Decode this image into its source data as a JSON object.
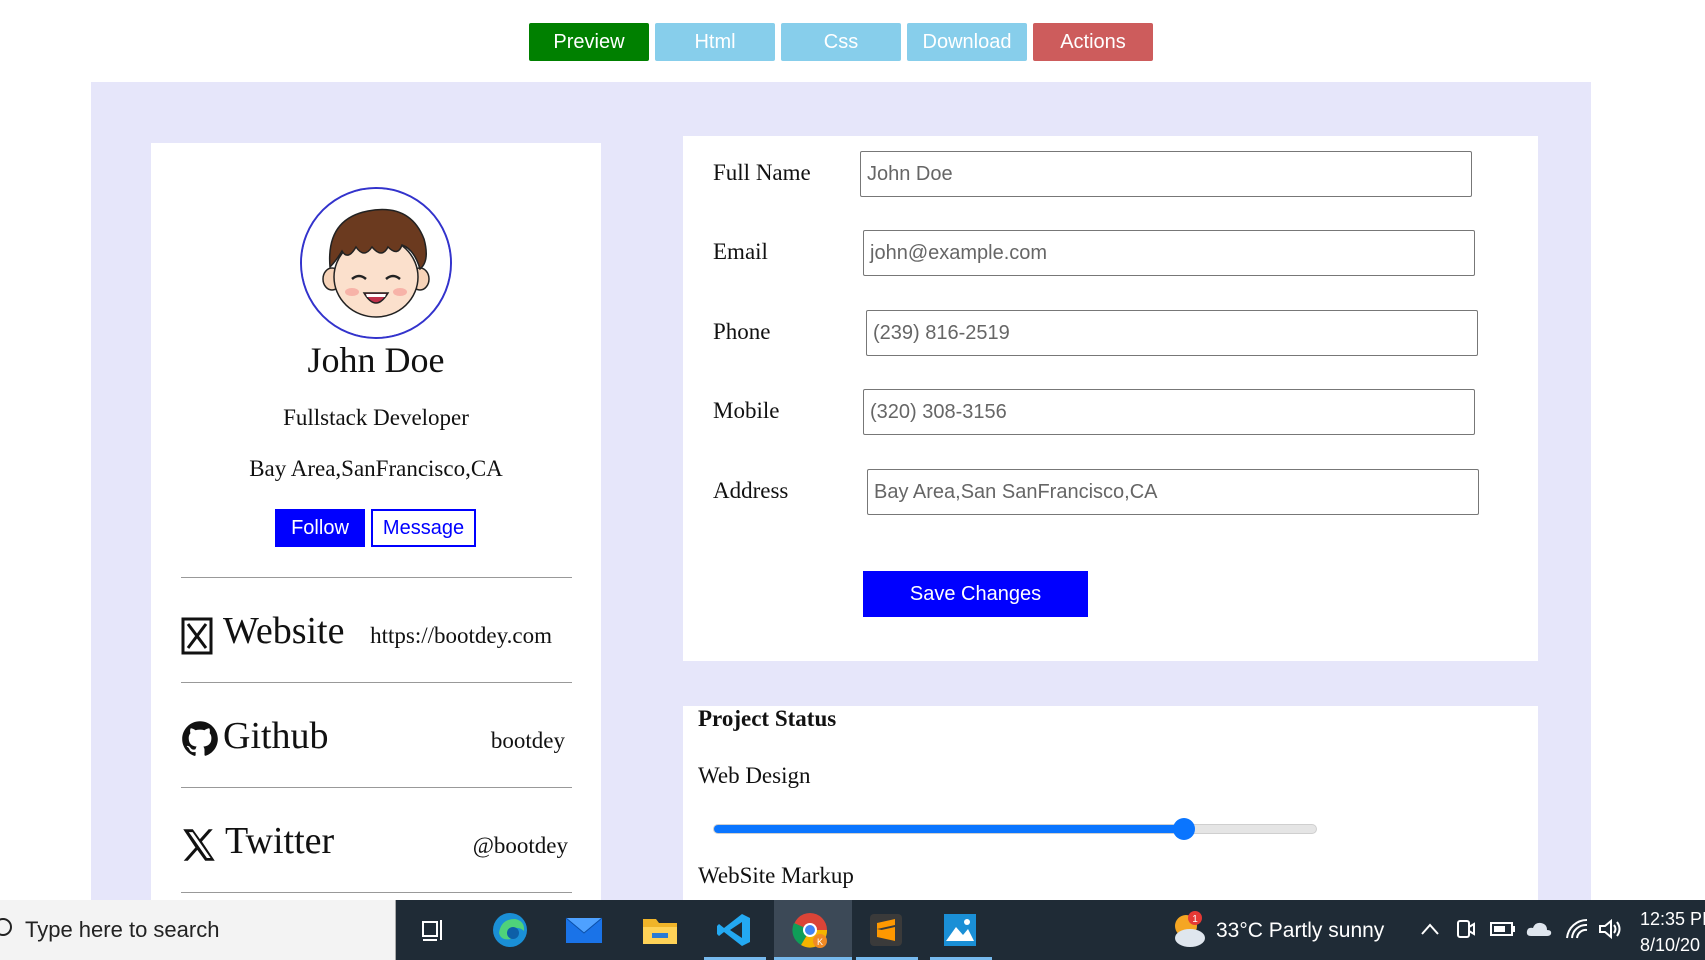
{
  "toolbar": {
    "preview": "Preview",
    "html": "Html",
    "css": "Css",
    "download": "Download",
    "actions": "Actions"
  },
  "profile": {
    "name": "John Doe",
    "role": "Fullstack Developer",
    "location": "Bay Area,SanFrancisco,CA",
    "follow": "Follow",
    "message": "Message",
    "links": [
      {
        "label": "Website",
        "value": "https://bootdey.com",
        "icon": "website-icon"
      },
      {
        "label": "Github",
        "value": "bootdey",
        "icon": "github-icon"
      },
      {
        "label": "Twitter",
        "value": "@bootdey",
        "icon": "x-twitter-icon"
      }
    ]
  },
  "form": {
    "full_name_label": "Full Name",
    "full_name_value": "John Doe",
    "email_label": "Email",
    "email_value": "john@example.com",
    "phone_label": "Phone",
    "phone_value": "(239) 816-2519",
    "mobile_label": "Mobile",
    "mobile_value": "(320) 308-3156",
    "address_label": "Address",
    "address_value": "Bay Area,San SanFrancisco,CA",
    "save": "Save Changes"
  },
  "project_status": {
    "title": "Project Status",
    "items": [
      {
        "label": "Web Design",
        "progress": 0.78
      },
      {
        "label": "WebSite Markup"
      }
    ]
  },
  "taskbar": {
    "search_placeholder": "Type here to search",
    "weather": "33°C  Partly sunny",
    "weather_badge": "1",
    "time": "12:35 PI",
    "date": "8/10/20"
  },
  "colors": {
    "preview": "#008000",
    "secondary": "#87ceeb",
    "actions": "#cd5c5c",
    "primary_blue": "#0000ff",
    "backdrop": "#e6e6fa",
    "slider": "#0a75ff"
  }
}
